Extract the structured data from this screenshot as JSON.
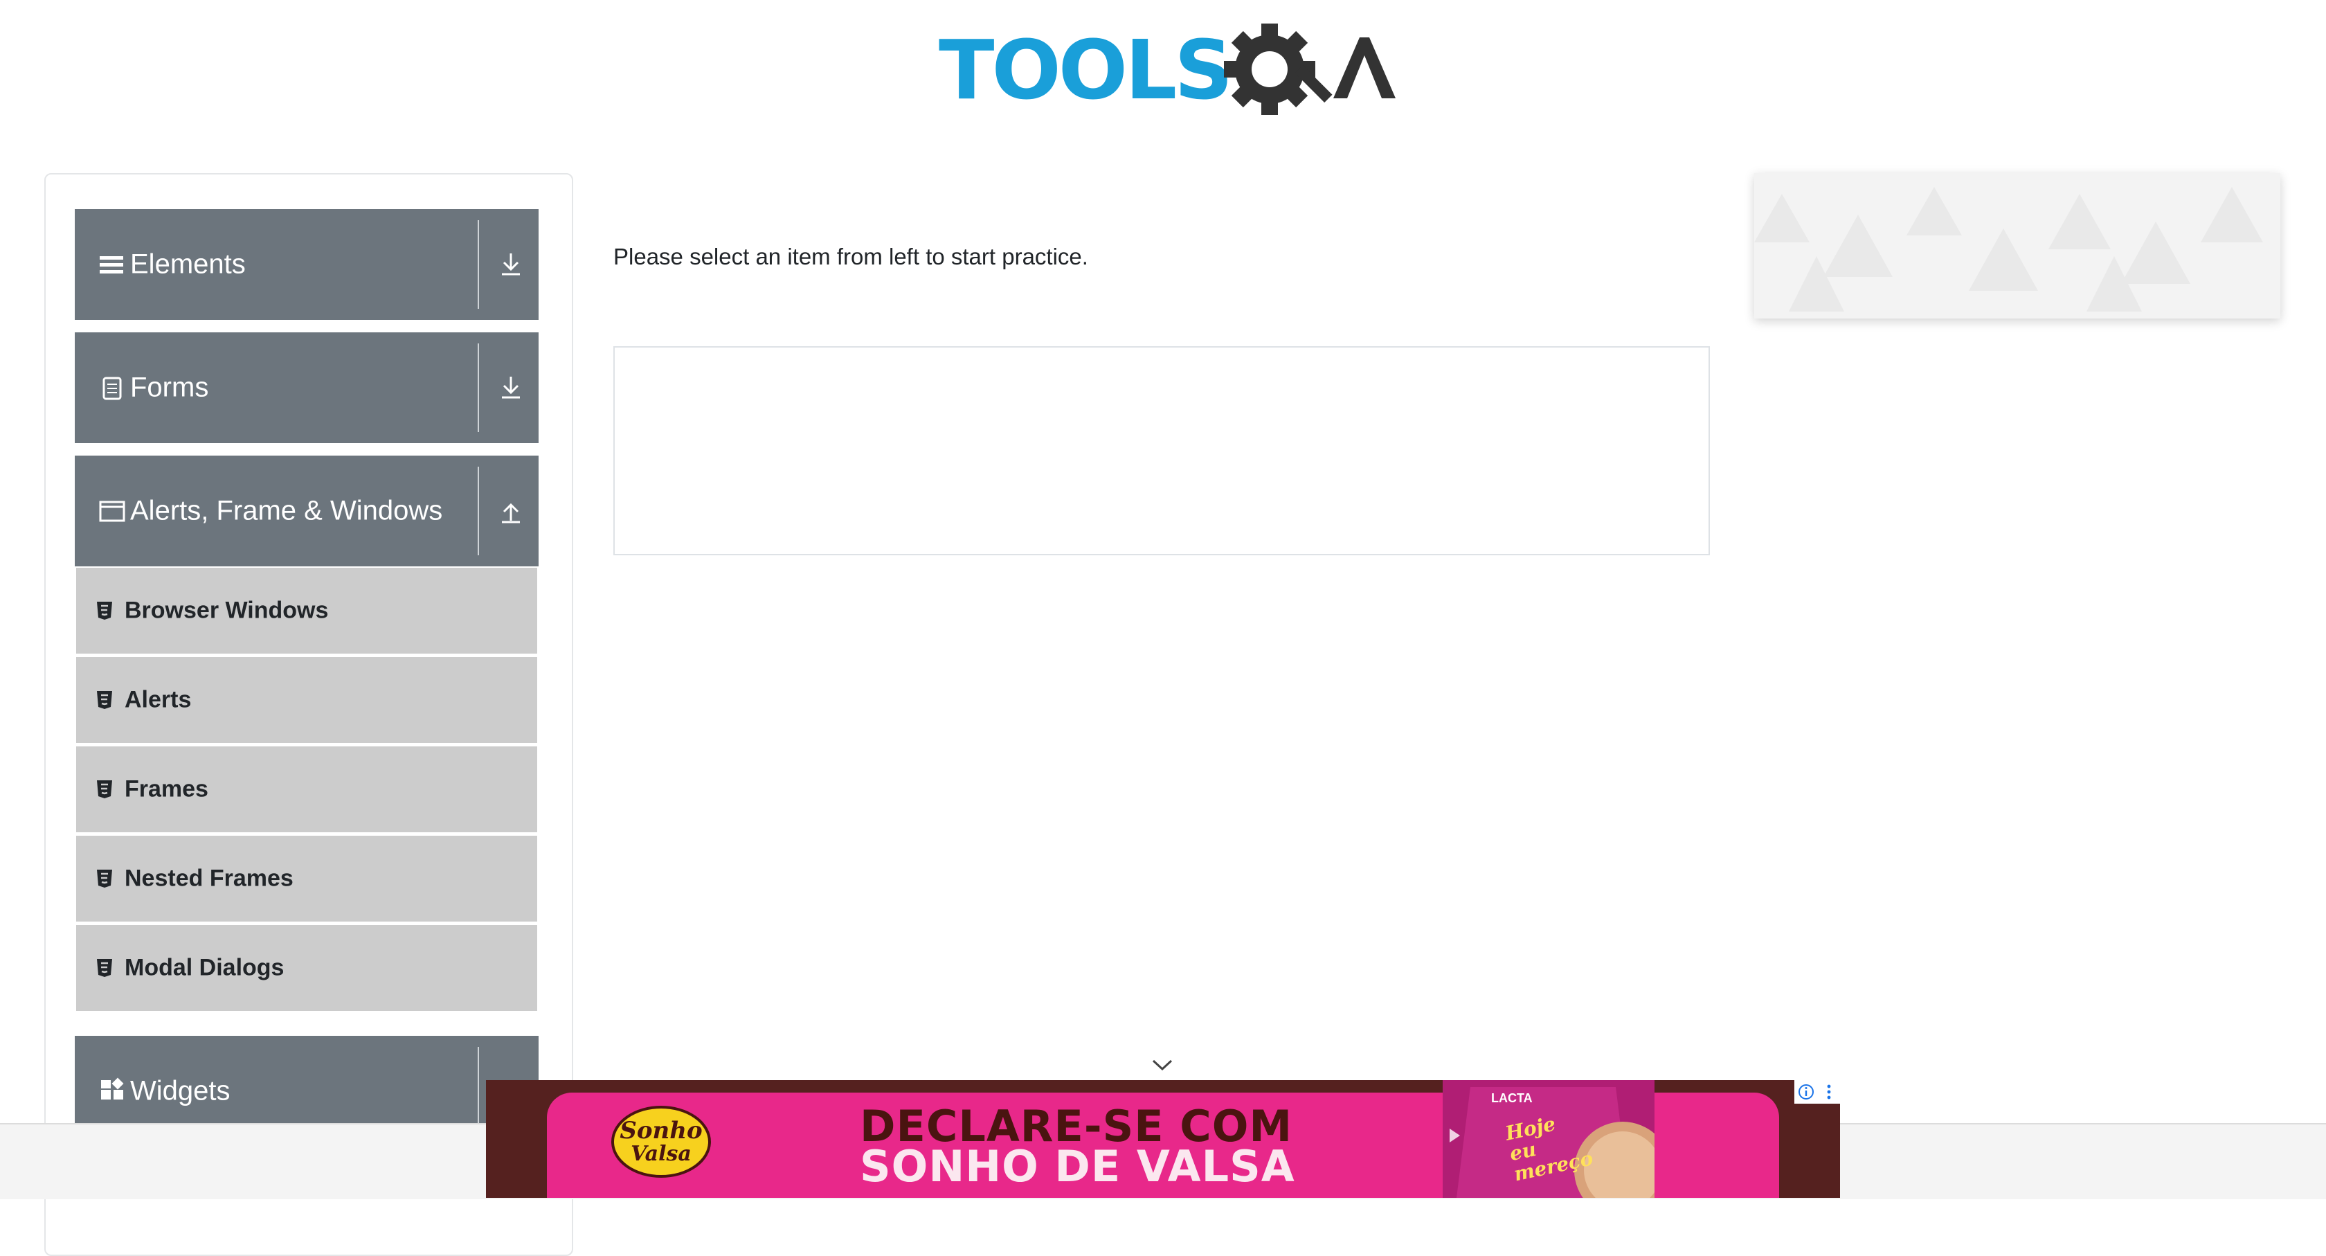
{
  "header": {
    "logo_text": "TOOLSQA",
    "logo_icon": "gear-magnifier-icon"
  },
  "sidebar": {
    "groups": [
      {
        "label": "Elements",
        "icon": "hamburger-icon",
        "arrow": "download-arrow-icon",
        "expanded": false
      },
      {
        "label": "Forms",
        "icon": "document-icon",
        "arrow": "download-arrow-icon",
        "expanded": false
      },
      {
        "label": "Alerts, Frame & Windows",
        "icon": "window-icon",
        "arrow": "upload-arrow-icon",
        "expanded": true,
        "items": [
          {
            "label": "Browser Windows",
            "icon": "html5-icon"
          },
          {
            "label": "Alerts",
            "icon": "html5-icon"
          },
          {
            "label": "Frames",
            "icon": "html5-icon"
          },
          {
            "label": "Nested Frames",
            "icon": "html5-icon"
          },
          {
            "label": "Modal Dialogs",
            "icon": "html5-icon"
          }
        ]
      },
      {
        "label": "Widgets",
        "icon": "widgets-icon",
        "arrow": "download-arrow-icon",
        "expanded": false
      }
    ]
  },
  "main": {
    "instruction": "Please select an item from left to start practice."
  },
  "bottom_ad": {
    "headline_line1": "DECLARE-SE COM",
    "headline_line2": "SONHO DE VALSA",
    "brand": "Sonho de Valsa",
    "product_tag": "LACTA",
    "product_slogan": "Hoje eu mereço",
    "colors": {
      "background": "#55211f",
      "pink": "#e8288a",
      "headline_dark": "#4a1410"
    }
  },
  "colors": {
    "header_gray": "#6c757d",
    "submenu_gray": "#cccccc",
    "logo_blue": "#1a9fd9",
    "logo_dark": "#333333"
  }
}
